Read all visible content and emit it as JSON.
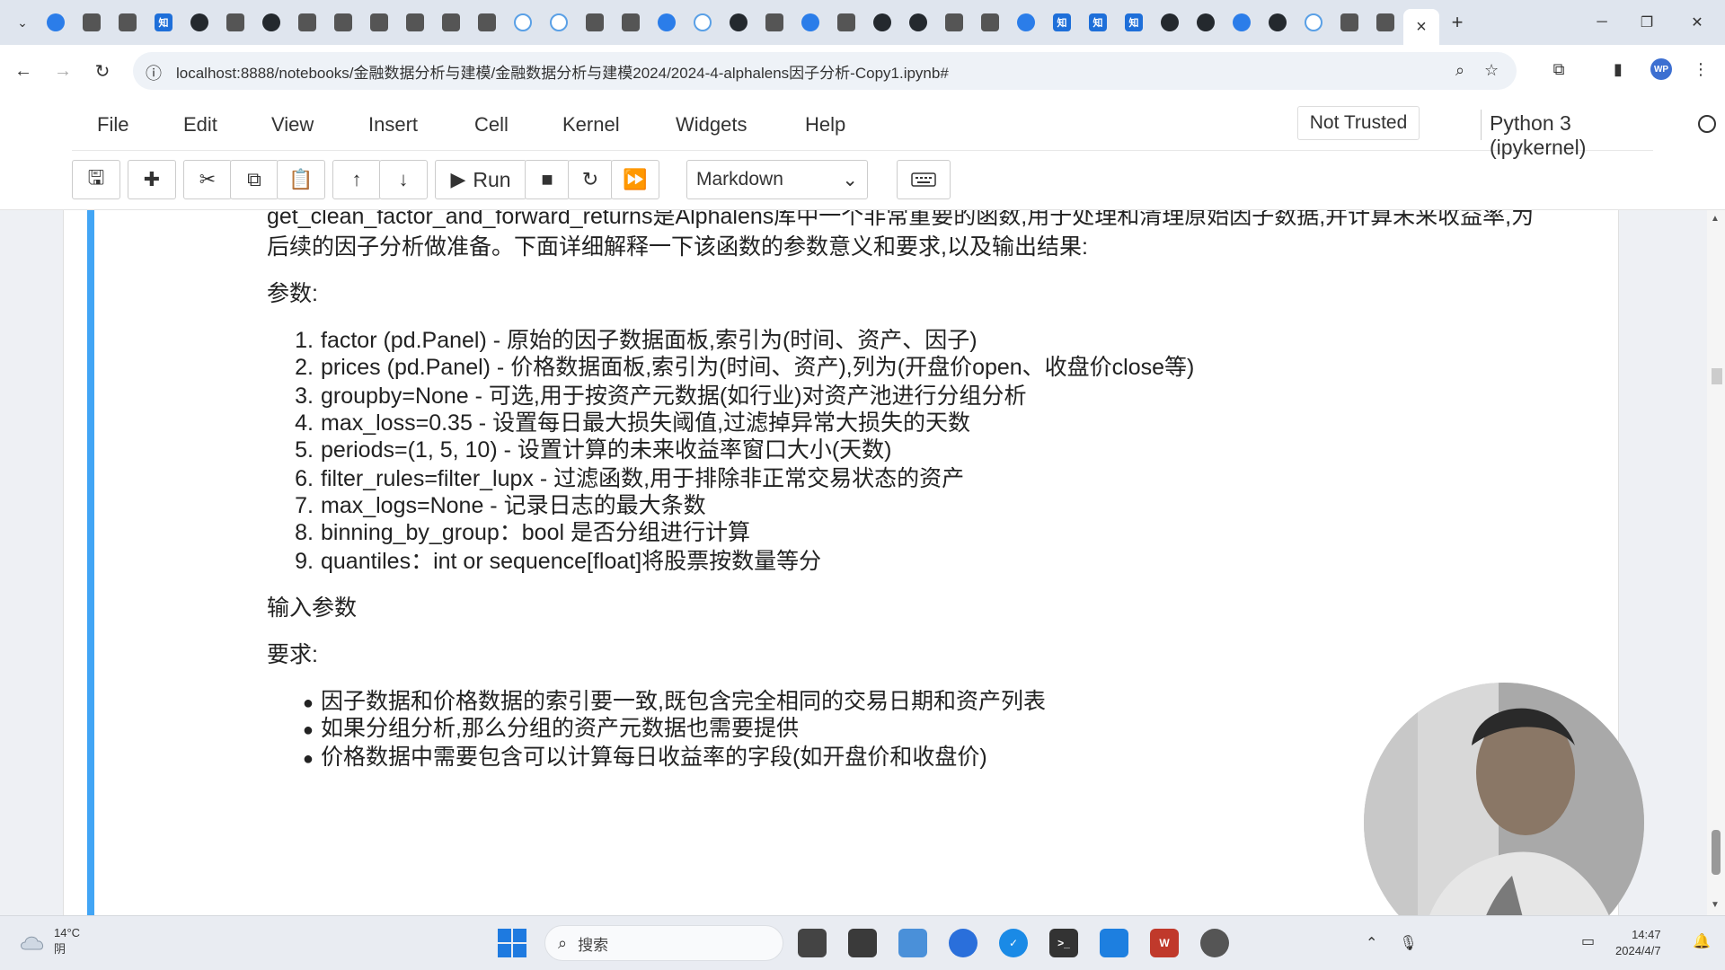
{
  "browser": {
    "active_tab_close": "×",
    "new_tab": "+",
    "url": "localhost:8888/notebooks/金融数据分析与建模/金融数据分析与建模2024/2024-4-alphalens因子分析-Copy1.ipynb#"
  },
  "menubar": {
    "items": [
      "File",
      "Edit",
      "View",
      "Insert",
      "Cell",
      "Kernel",
      "Widgets",
      "Help"
    ],
    "trust_status": "Not Trusted",
    "kernel_name": "Python 3 (ipykernel)"
  },
  "toolbar": {
    "run_label": "Run",
    "cell_type": "Markdown"
  },
  "cell": {
    "intro_line1": "get_clean_factor_and_forward_returns是Alphalens库中一个非常重要的函数,用于处理和清理原始因子数据,并计算未来收益率,为",
    "intro_line2": "后续的因子分析做准备。下面详细解释一下该函数的参数意义和要求,以及输出结果:",
    "params_heading": "参数:",
    "params": [
      "factor (pd.Panel) - 原始的因子数据面板,索引为(时间、资产、因子)",
      "prices (pd.Panel) - 价格数据面板,索引为(时间、资产),列为(开盘价open、收盘价close等)",
      "groupby=None - 可选,用于按资产元数据(如行业)对资产池进行分组分析",
      "max_loss=0.35 - 设置每日最大损失阈值,过滤掉异常大损失的天数",
      "periods=(1, 5, 10) - 设置计算的未来收益率窗口大小(天数)",
      "filter_rules=filter_lupx - 过滤函数,用于排除非正常交易状态的资产",
      "max_logs=None - 记录日志的最大条数",
      "binning_by_group：bool 是否分组进行计算",
      "quantiles：int or sequence[float]将股票按数量等分"
    ],
    "input_heading": "输入参数",
    "req_heading": "要求:",
    "requirements": [
      "因子数据和价格数据的索引要一致,既包含完全相同的交易日期和资产列表",
      "如果分组分析,那么分组的资产元数据也需要提供",
      "价格数据中需要包含可以计算每日收益率的字段(如开盘价和收盘价)"
    ]
  },
  "taskbar": {
    "temperature": "14°C",
    "weather": "阴",
    "search_label": "搜索",
    "time": "14:47",
    "date": "2024/4/7"
  }
}
